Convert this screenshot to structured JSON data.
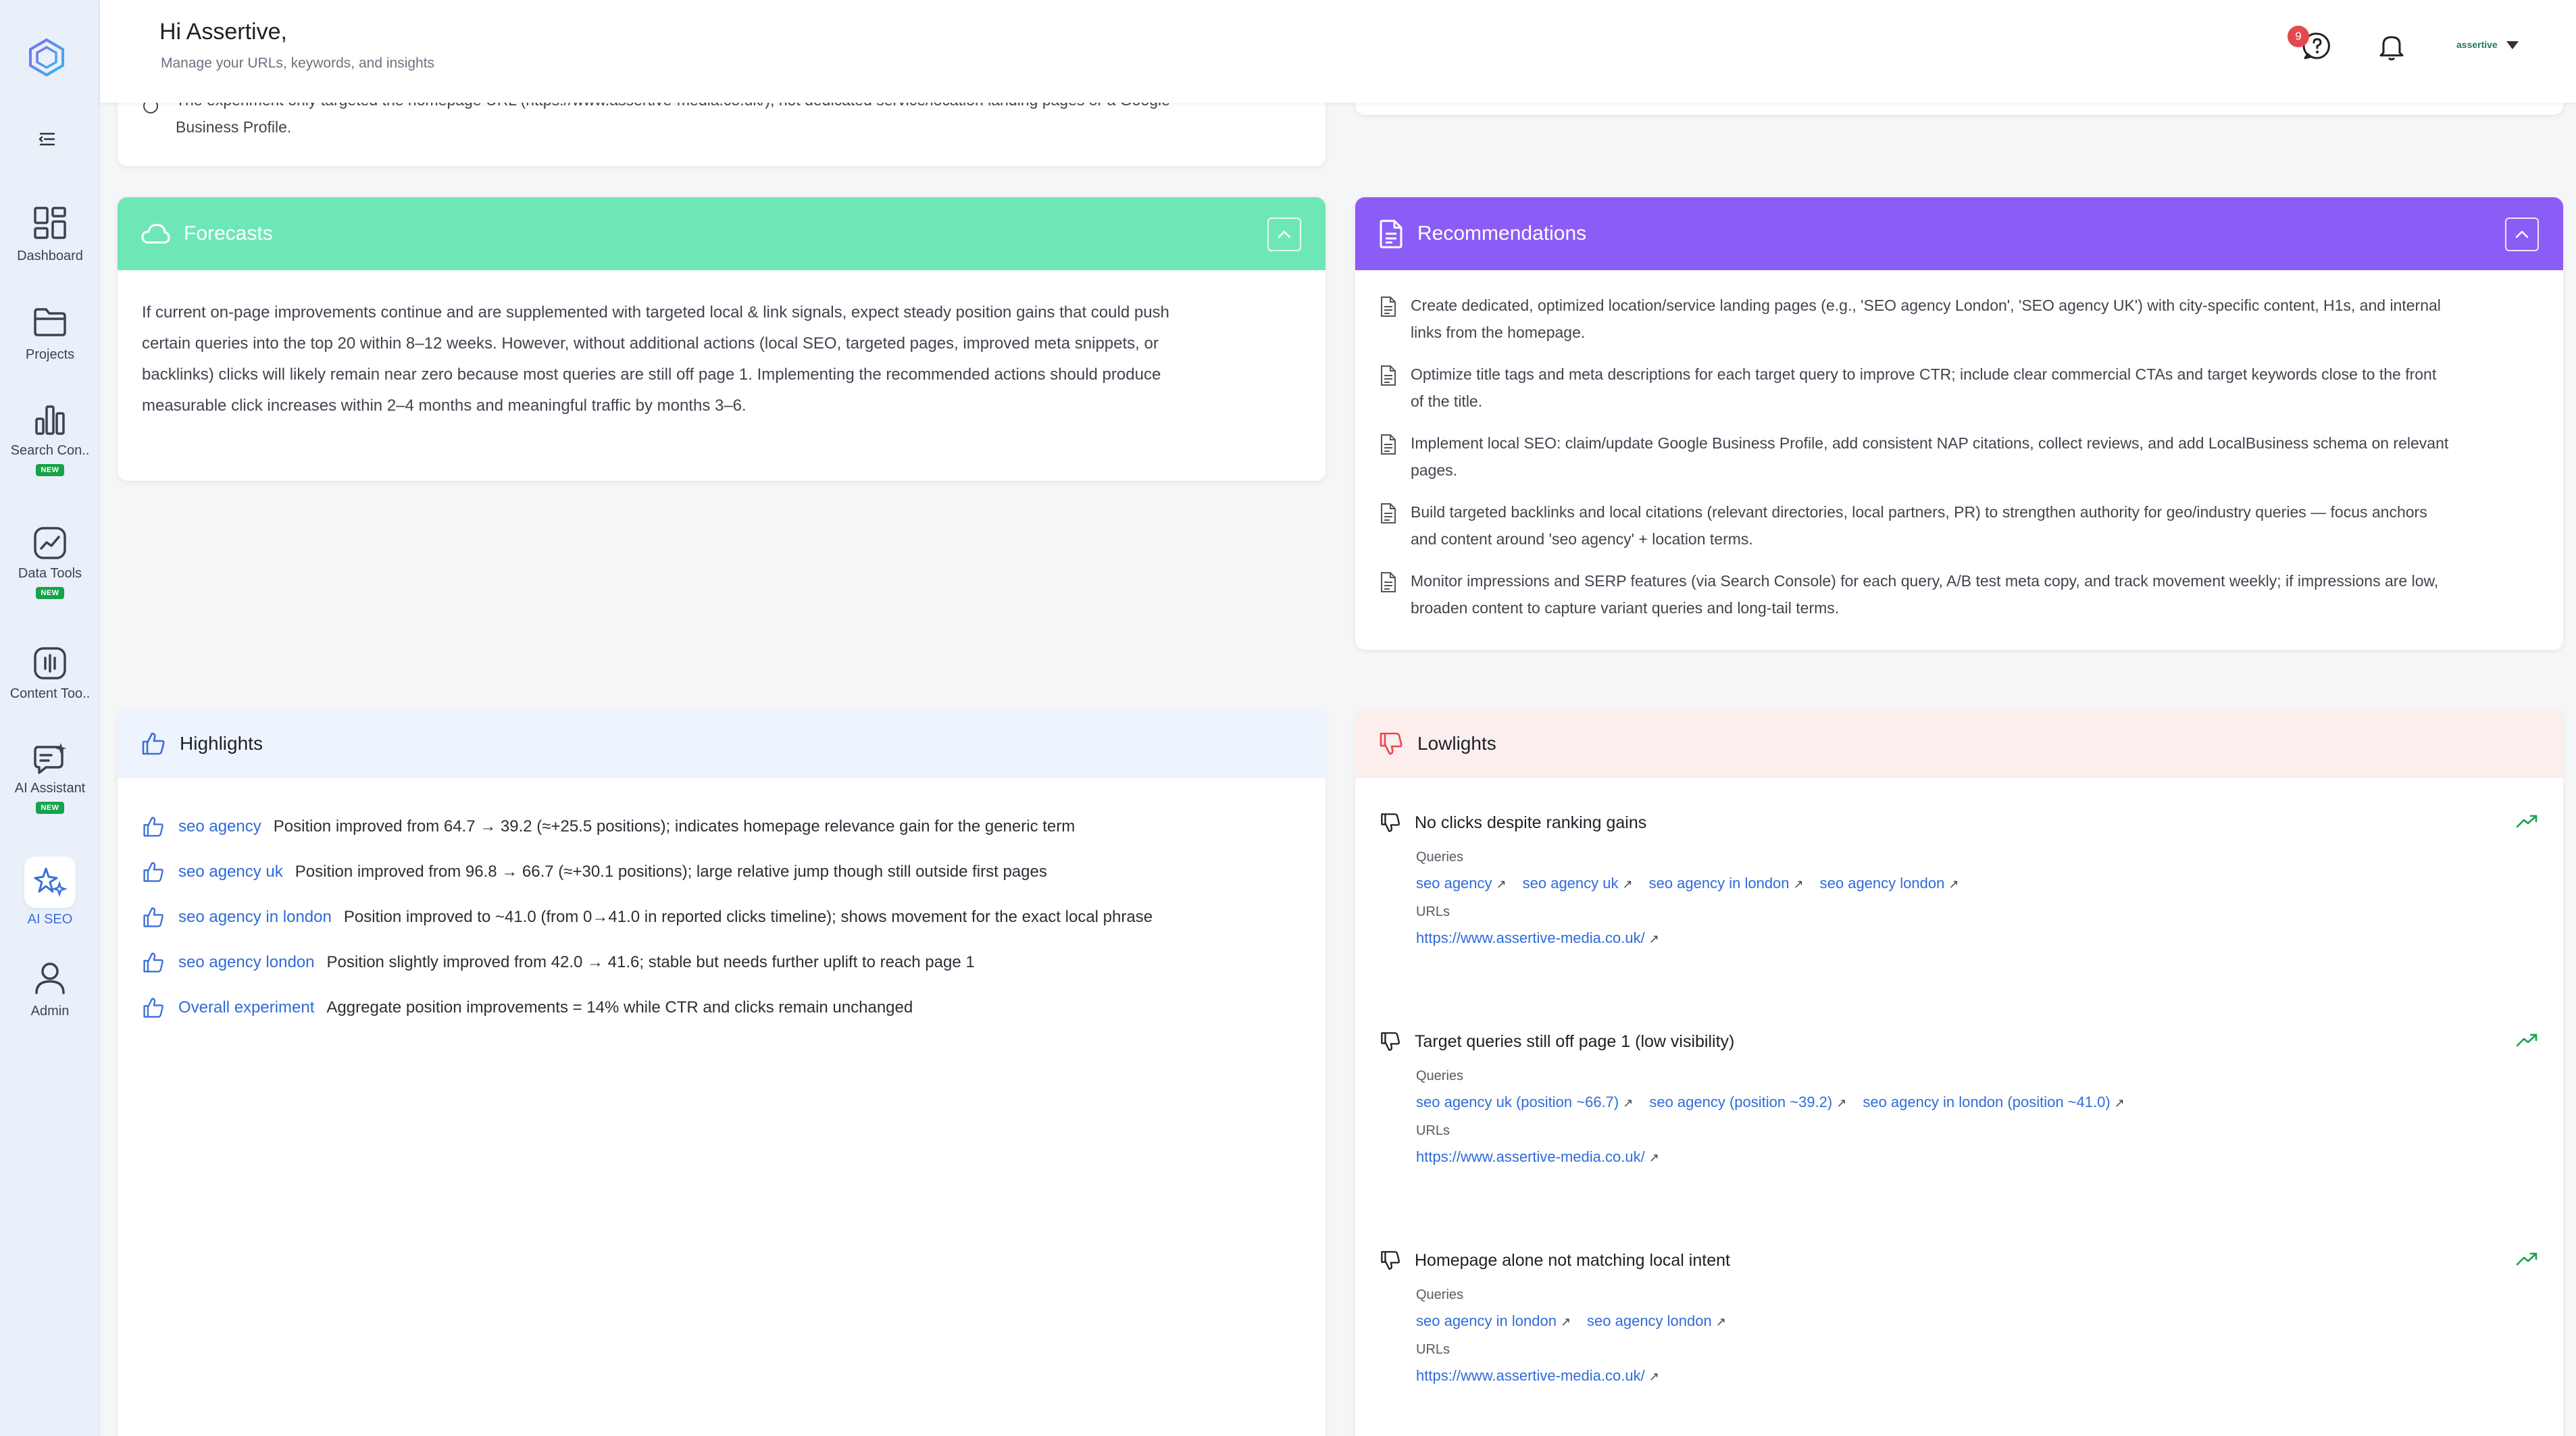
{
  "header": {
    "greeting": "Hi Assertive,",
    "subtitle": "Manage your URLs, keywords, and insights",
    "notification_count": "9",
    "user_name": "assertive"
  },
  "sidebar": {
    "items": [
      {
        "label": "Dashboard",
        "icon": "dashboard-icon",
        "badge": ""
      },
      {
        "label": "Projects",
        "icon": "folder-icon",
        "badge": ""
      },
      {
        "label": "Search Con..",
        "icon": "bar-chart-icon",
        "badge": "NEW"
      },
      {
        "label": "Data Tools",
        "icon": "line-chart-icon",
        "badge": "NEW"
      },
      {
        "label": "Content Too..",
        "icon": "content-tools-icon",
        "badge": ""
      },
      {
        "label": "AI Assistant",
        "icon": "chat-sparkle-icon",
        "badge": "NEW"
      },
      {
        "label": "AI SEO",
        "icon": "sparkle-stars-icon",
        "badge": ""
      },
      {
        "label": "Admin",
        "icon": "user-icon",
        "badge": ""
      }
    ]
  },
  "top_card": {
    "line1": "The experiment only targeted the homepage URL (https://www.assertive-media.co.uk/), not dedicated service/location landing pages or a Google",
    "line2": "Business Profile."
  },
  "forecasts": {
    "title": "Forecasts",
    "lines": [
      "If current on-page improvements continue and are supplemented with targeted local & link signals, expect steady position gains that could push",
      "certain queries into the top 20 within 8–12 weeks. However, without additional actions (local SEO, targeted pages, improved meta snippets, or",
      "backlinks) clicks will likely remain near zero because most queries are still off page 1. Implementing the recommended actions should produce",
      "measurable click increases within 2–4 months and meaningful traffic by months 3–6."
    ]
  },
  "recommendations": {
    "title": "Recommendations",
    "items": [
      [
        "Create dedicated, optimized location/service landing pages (e.g., 'SEO agency London', 'SEO agency UK') with city-specific content, H1s, and internal",
        "links from the homepage."
      ],
      [
        "Optimize title tags and meta descriptions for each target query to improve CTR; include clear commercial CTAs and target keywords close to the front",
        "of the title."
      ],
      [
        "Implement local SEO: claim/update Google Business Profile, add consistent NAP citations, collect reviews, and add LocalBusiness schema on relevant",
        "pages."
      ],
      [
        "Build targeted backlinks and local citations (relevant directories, local partners, PR) to strengthen authority for geo/industry queries — focus anchors",
        "and content around 'seo agency' + location terms."
      ],
      [
        "Monitor impressions and SERP features (via Search Console) for each query, A/B test meta copy, and track movement weekly; if impressions are low,",
        "broaden content to capture variant queries and long-tail terms."
      ]
    ]
  },
  "highlights": {
    "title": "Highlights",
    "items": [
      {
        "query": "seo agency",
        "desc": "Position improved from 64.7 → 39.2 (≈+25.5 positions); indicates homepage relevance gain for the generic term"
      },
      {
        "query": "seo agency uk",
        "desc": "Position improved from 96.8 → 66.7 (≈+30.1 positions); large relative jump though still outside first pages"
      },
      {
        "query": "seo agency in london",
        "desc": "Position improved to ~41.0 (from 0→41.0 in reported clicks timeline); shows movement for the exact local phrase"
      },
      {
        "query": "seo agency london",
        "desc": "Position slightly improved from 42.0 → 41.6; stable but needs further uplift to reach page 1"
      },
      {
        "query": "Overall experiment",
        "desc": "Aggregate position improvements = 14% while CTR and clicks remain unchanged"
      }
    ]
  },
  "lowlights": {
    "title": "Lowlights",
    "queries_label": "Queries",
    "urls_label": "URLs",
    "blocks": [
      {
        "title": "No clicks despite ranking gains",
        "queries": [
          "seo agency",
          "seo agency uk",
          "seo agency in london",
          "seo agency london"
        ],
        "url": "https://www.assertive-media.co.uk/"
      },
      {
        "title": "Target queries still off page 1 (low visibility)",
        "queries": [
          "seo agency uk (position ~66.7)",
          "seo agency (position ~39.2)",
          "seo agency in london (position ~41.0)"
        ],
        "url": "https://www.assertive-media.co.uk/"
      },
      {
        "title": "Homepage alone not matching local intent",
        "queries": [
          "seo agency in london",
          "seo agency london"
        ],
        "url": "https://www.assertive-media.co.uk/"
      }
    ]
  },
  "colors": {
    "forecast_header": "#6ee7b7",
    "recommendation_header": "#8b5cf6",
    "highlight_header": "#eef4fd",
    "lowlight_header": "#fdeeee",
    "link": "#2f6bd8",
    "trend_green": "#16a34a"
  }
}
